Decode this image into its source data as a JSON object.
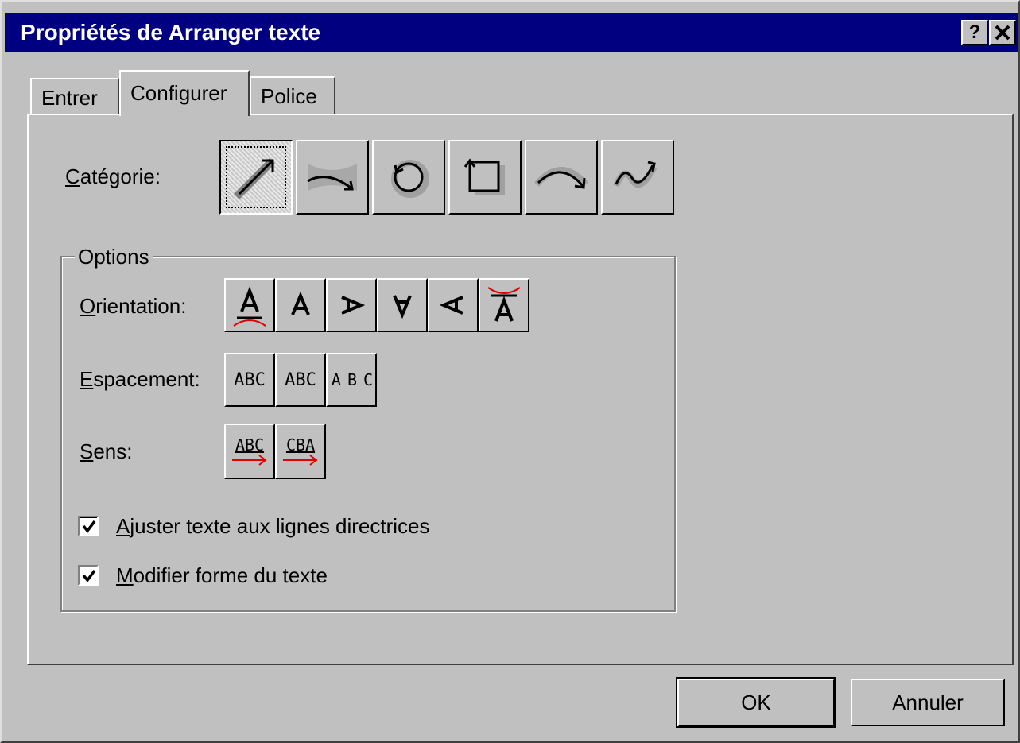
{
  "window": {
    "title": "Propriétés de Arranger texte",
    "help_label": "?",
    "close_label": "✕"
  },
  "tabs": [
    {
      "label": "Entrer",
      "active": false
    },
    {
      "label": "Configurer",
      "active": true
    },
    {
      "label": "Police",
      "active": false
    }
  ],
  "category": {
    "label": "Catégorie:",
    "accel": "C",
    "label_rest": "atégorie:",
    "buttons": [
      {
        "icon": "straight-line-icon",
        "selected": true
      },
      {
        "icon": "envelope-curve-icon",
        "selected": false
      },
      {
        "icon": "circle-icon",
        "selected": false
      },
      {
        "icon": "rectangle-icon",
        "selected": false
      },
      {
        "icon": "arc-icon",
        "selected": false
      },
      {
        "icon": "wave-curve-icon",
        "selected": false
      }
    ]
  },
  "options": {
    "legend": "Options",
    "orientation": {
      "accel": "O",
      "label_rest": "rientation:",
      "buttons": [
        {
          "icon": "orient-upright-curve-icon",
          "selected": true
        },
        {
          "icon": "orient-up-icon",
          "selected": false
        },
        {
          "icon": "orient-right-icon",
          "selected": false
        },
        {
          "icon": "orient-down-icon",
          "selected": false
        },
        {
          "icon": "orient-left-icon",
          "selected": false
        },
        {
          "icon": "orient-upright-arch-icon",
          "selected": false
        }
      ]
    },
    "spacing": {
      "accel": "E",
      "label_rest": "spacement:",
      "buttons": [
        {
          "text": "ABC",
          "selected": false
        },
        {
          "text": "ABC",
          "selected": true
        },
        {
          "text": "A B C",
          "selected": false
        }
      ]
    },
    "direction": {
      "accel": "S",
      "label_rest": "ens:",
      "buttons": [
        {
          "text": "ABC",
          "selected": true
        },
        {
          "text": "CBA",
          "selected": false
        }
      ]
    },
    "checkboxes": [
      {
        "accel": "A",
        "label_rest": "juster texte aux lignes directrices",
        "checked": true
      },
      {
        "accel": "M",
        "label_rest": "odifier forme du texte",
        "checked": true
      }
    ]
  },
  "footer": {
    "ok_label": "OK",
    "cancel_label": "Annuler"
  },
  "colors": {
    "face": "#c0c0c0",
    "titlebar": "#000080",
    "accent_red": "#e00000"
  }
}
